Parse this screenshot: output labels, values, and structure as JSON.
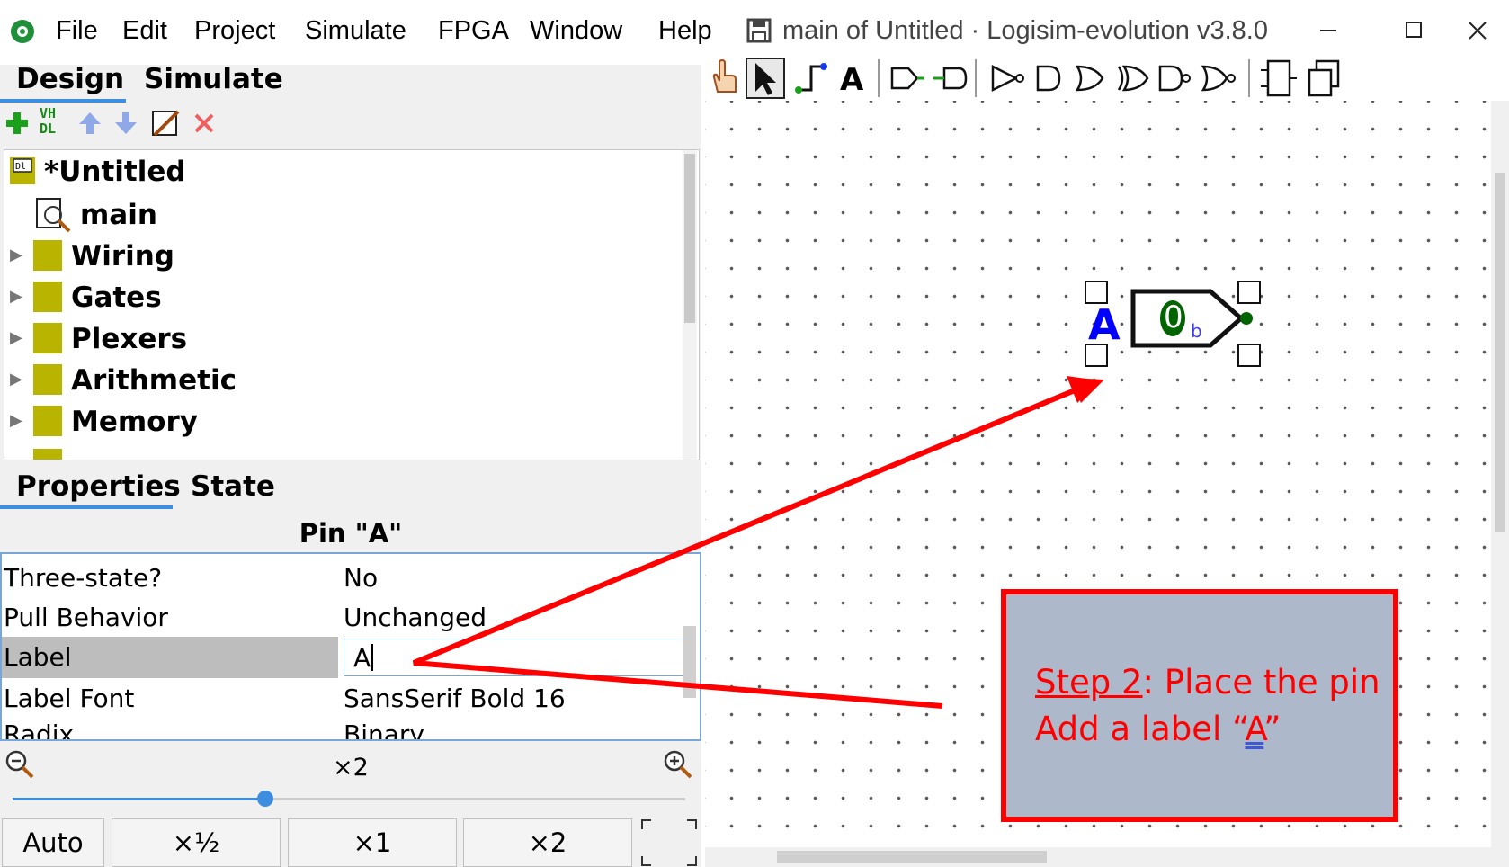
{
  "titlebar": {
    "menu": [
      "File",
      "Edit",
      "Project",
      "Simulate",
      "FPGA",
      "Window",
      "Help"
    ],
    "title": "main of Untitled · Logisim-evolution v3.8.0"
  },
  "left_tabs": {
    "design": "Design",
    "simulate": "Simulate"
  },
  "toolbar_left": {
    "vhdl": "VH\nDL"
  },
  "tree": {
    "project": "*Untitled",
    "circuit": "main",
    "folders": [
      "Wiring",
      "Gates",
      "Plexers",
      "Arithmetic",
      "Memory"
    ]
  },
  "props_tabs": {
    "properties": "Properties",
    "state": "State"
  },
  "props": {
    "header": "Pin \"A\"",
    "rows": [
      {
        "name": "Three-state?",
        "value": "No"
      },
      {
        "name": "Pull Behavior",
        "value": "Unchanged"
      },
      {
        "name": "Label",
        "value": "A"
      },
      {
        "name": "Label Font",
        "value": "SansSerif Bold 16"
      },
      {
        "name": "Radix",
        "value": "Binary"
      }
    ]
  },
  "zoom": {
    "level": "×2",
    "slider_fraction": 0.375,
    "buttons": [
      "Auto",
      "×½",
      "×1",
      "×2"
    ]
  },
  "canvas": {
    "pin_label": "A",
    "pin_value": "0",
    "pin_radix_suffix": "b"
  },
  "note": {
    "step": "Step 2",
    "line1_rest": ":  Place the pin",
    "line2_prefix": "Add a label “",
    "line2_a": "A",
    "line2_suffix": "”"
  },
  "colors": {
    "accent": "#3d8ee0",
    "annotation": "#ff0000",
    "note_bg": "#adb9ca",
    "folder": "#b9b400",
    "pin_green": "#006400",
    "label_blue": "#0000ff"
  }
}
